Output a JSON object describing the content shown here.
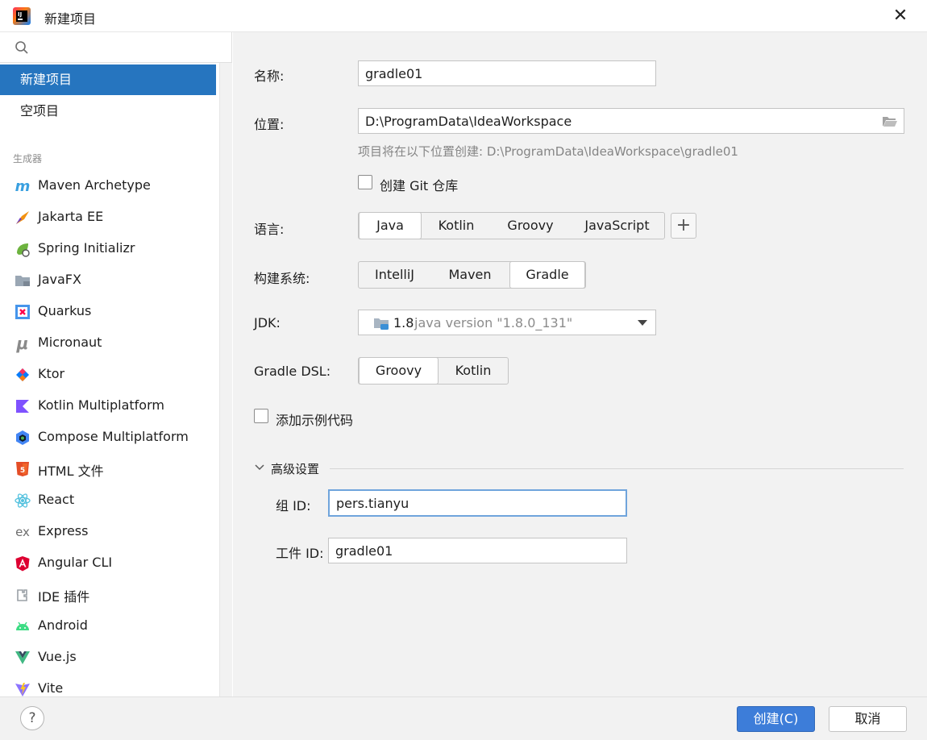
{
  "window": {
    "title": "新建项目",
    "close_glyph": "✕"
  },
  "sidebar": {
    "search_placeholder": "",
    "top_items": [
      {
        "label": "新建项目",
        "selected": true
      },
      {
        "label": "空项目",
        "selected": false
      }
    ],
    "generators_label": "生成器",
    "generators": [
      {
        "label": "Maven Archetype",
        "icon": "maven-icon"
      },
      {
        "label": "Jakarta EE",
        "icon": "jakarta-icon"
      },
      {
        "label": "Spring Initializr",
        "icon": "spring-icon"
      },
      {
        "label": "JavaFX",
        "icon": "javafx-icon"
      },
      {
        "label": "Quarkus",
        "icon": "quarkus-icon"
      },
      {
        "label": "Micronaut",
        "icon": "micronaut-icon"
      },
      {
        "label": "Ktor",
        "icon": "ktor-icon"
      },
      {
        "label": "Kotlin Multiplatform",
        "icon": "kotlin-icon"
      },
      {
        "label": "Compose Multiplatform",
        "icon": "compose-icon"
      },
      {
        "label": "HTML 文件",
        "icon": "html5-icon"
      },
      {
        "label": "React",
        "icon": "react-icon"
      },
      {
        "label": "Express",
        "icon": "express-icon"
      },
      {
        "label": "Angular CLI",
        "icon": "angular-icon"
      },
      {
        "label": "IDE 插件",
        "icon": "plugin-icon"
      },
      {
        "label": "Android",
        "icon": "android-icon"
      },
      {
        "label": "Vue.js",
        "icon": "vue-icon"
      },
      {
        "label": "Vite",
        "icon": "vite-icon"
      }
    ]
  },
  "form": {
    "name_label": "名称:",
    "name_value": "gradle01",
    "location_label": "位置:",
    "location_value": "D:\\ProgramData\\IdeaWorkspace",
    "location_hint": "项目将在以下位置创建: D:\\ProgramData\\IdeaWorkspace\\gradle01",
    "git_label": "创建 Git 仓库",
    "git_checked": false,
    "language_label": "语言:",
    "languages": [
      "Java",
      "Kotlin",
      "Groovy",
      "JavaScript"
    ],
    "language_selected": "Java",
    "add_glyph": "+",
    "build_label": "构建系统:",
    "builds": [
      "IntelliJ",
      "Maven",
      "Gradle"
    ],
    "build_selected": "Gradle",
    "jdk_label": "JDK:",
    "jdk_version": "1.8",
    "jdk_desc": "java version \"1.8.0_131\"",
    "dsl_label": "Gradle DSL:",
    "dsls": [
      "Groovy",
      "Kotlin"
    ],
    "dsl_selected": "Groovy",
    "sample_label": "添加示例代码",
    "sample_checked": false,
    "advanced_label": "高级设置",
    "group_label": "组 ID:",
    "group_value": "pers.tianyu",
    "artifact_label": "工件 ID:",
    "artifact_value": "gradle01"
  },
  "footer": {
    "help_glyph": "?",
    "create_label": "创建(C)",
    "cancel_label": "取消"
  },
  "colors": {
    "selection": "#2675bf",
    "primary_button": "#3d7dd9",
    "focus_border": "#6fa4dc"
  }
}
